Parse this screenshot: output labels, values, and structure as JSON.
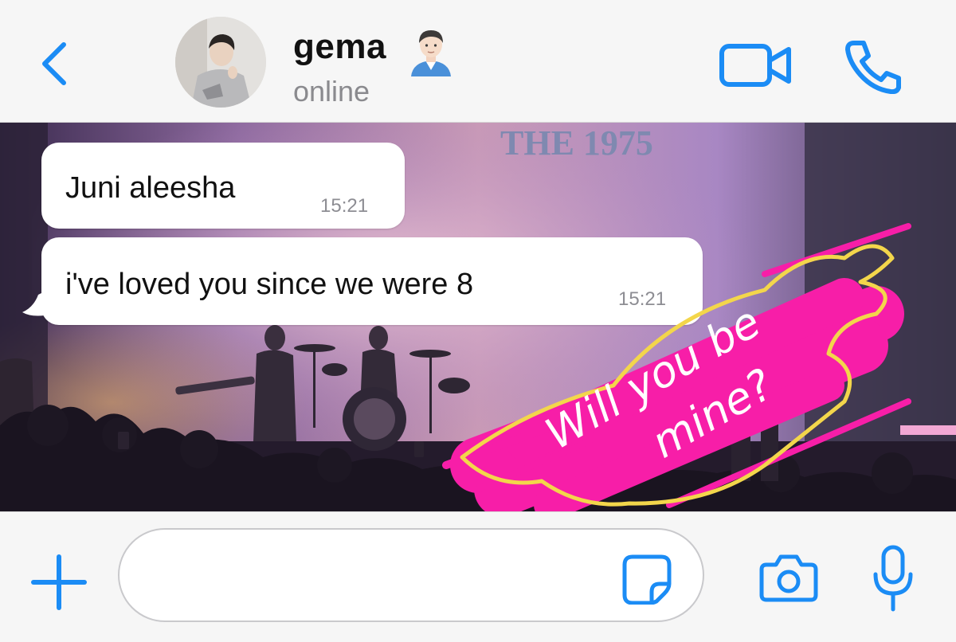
{
  "colors": {
    "accent": "#1b8cf5",
    "sticker_pink": "#f71ea8",
    "sticker_outline": "#f3d64b"
  },
  "header": {
    "contact_name": "gema",
    "contact_status": "online",
    "icons": [
      "back-icon",
      "avatar",
      "person-emoji-icon",
      "video-call-icon",
      "phone-icon"
    ]
  },
  "messages": [
    {
      "text": "Juni aleesha",
      "time": "15:21"
    },
    {
      "text": "i've loved you since we were 8",
      "time": "15:21"
    }
  ],
  "sticker": {
    "line1": "Will you be",
    "line2": "mine?"
  },
  "background_sign": "THE 1975",
  "input_bar": {
    "placeholder": "",
    "icons": [
      "plus-icon",
      "sticker-icon",
      "camera-icon",
      "microphone-icon"
    ]
  }
}
